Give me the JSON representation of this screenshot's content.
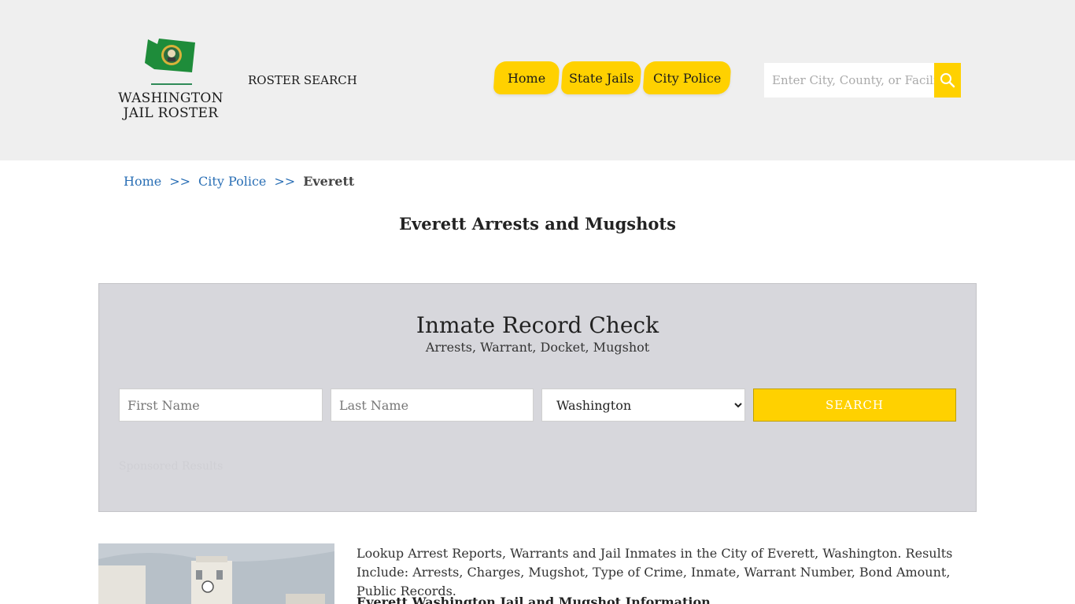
{
  "header": {
    "logo_text_line1": "WASHINGTON",
    "logo_text_line2": "JAIL ROSTER",
    "roster_search": "ROSTER SEARCH",
    "nav": [
      "Home",
      "State Jails",
      "City Police"
    ],
    "search_placeholder": "Enter City, County, or Facility"
  },
  "breadcrumb": {
    "items": [
      "Home",
      "City Police"
    ],
    "separator": ">>",
    "current": "Everett"
  },
  "page_title": "Everett Arrests and Mugshots",
  "record_check": {
    "title": "Inmate Record Check",
    "subtitle": "Arrests, Warrant, Docket, Mugshot",
    "first_name_placeholder": "First Name",
    "last_name_placeholder": "Last Name",
    "state_selected": "Washington",
    "search_label": "SEARCH",
    "sponsored": "Sponsored Results"
  },
  "content": {
    "intro": "Lookup Arrest Reports, Warrants and Jail Inmates in the City of Everett, Washington. Results Include: Arrests, Charges, Mugshot, Type of Crime, Inmate, Warrant Number, Bond Amount, Public Records.",
    "subheading": "Everett Washington Jail and Mugshot Information"
  },
  "colors": {
    "header_bg": "#efefef",
    "accent": "#ffd100",
    "link": "#2a6fb5",
    "panel_bg": "#d7d7dc"
  }
}
